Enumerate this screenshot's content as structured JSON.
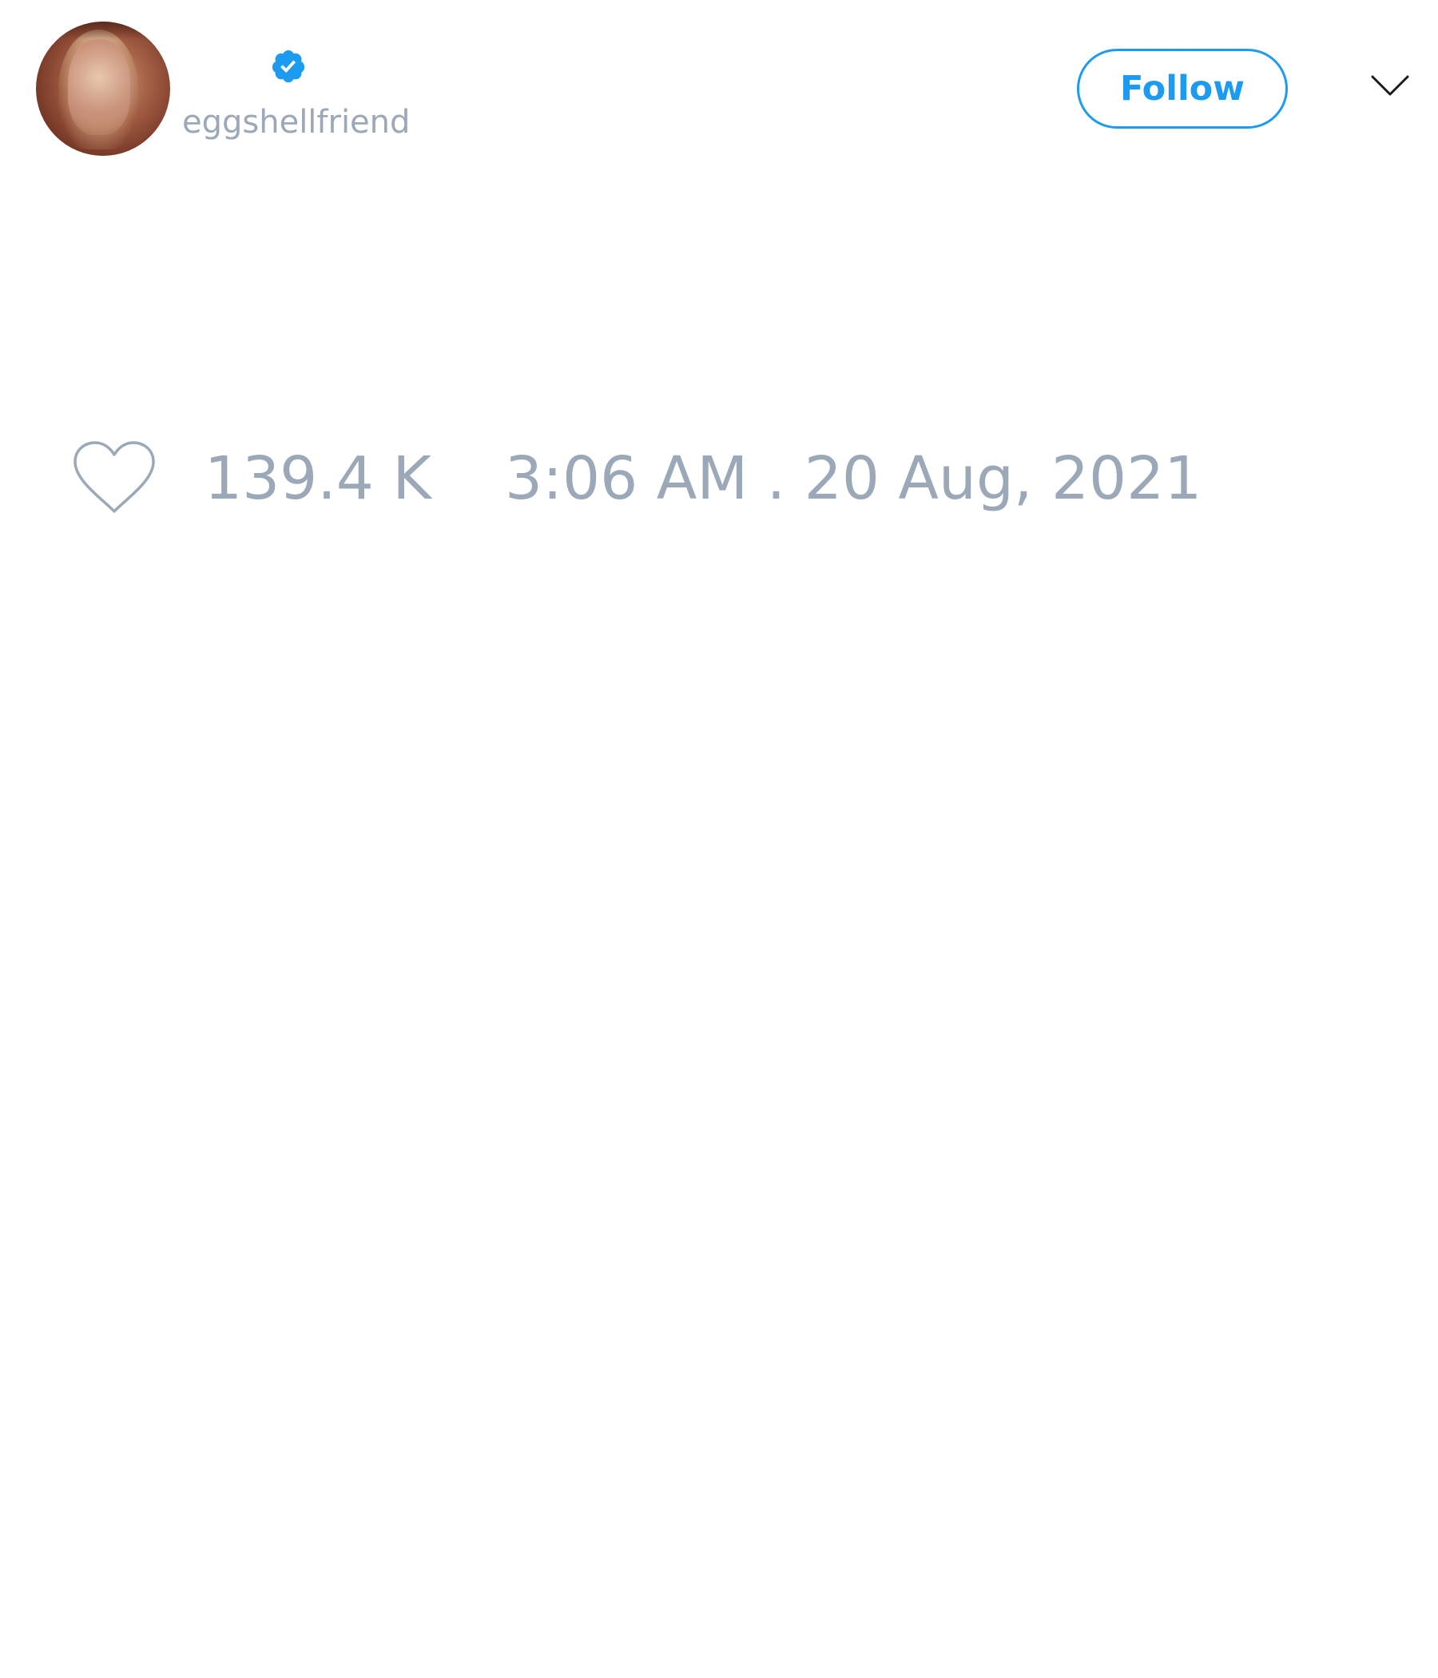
{
  "header": {
    "handle": "eggshellfriend",
    "follow_label": "Follow",
    "verified_icon": "verified-badge-icon",
    "menu_icon": "chevron-down-icon"
  },
  "stats": {
    "like_icon": "heart-icon",
    "likes": "139.4 K",
    "timestamp": "3:06 AM . 20 Aug, 2021"
  },
  "colors": {
    "accent": "#1d9bf0",
    "muted_text": "#9aa8b8",
    "background": "#ffffff"
  }
}
